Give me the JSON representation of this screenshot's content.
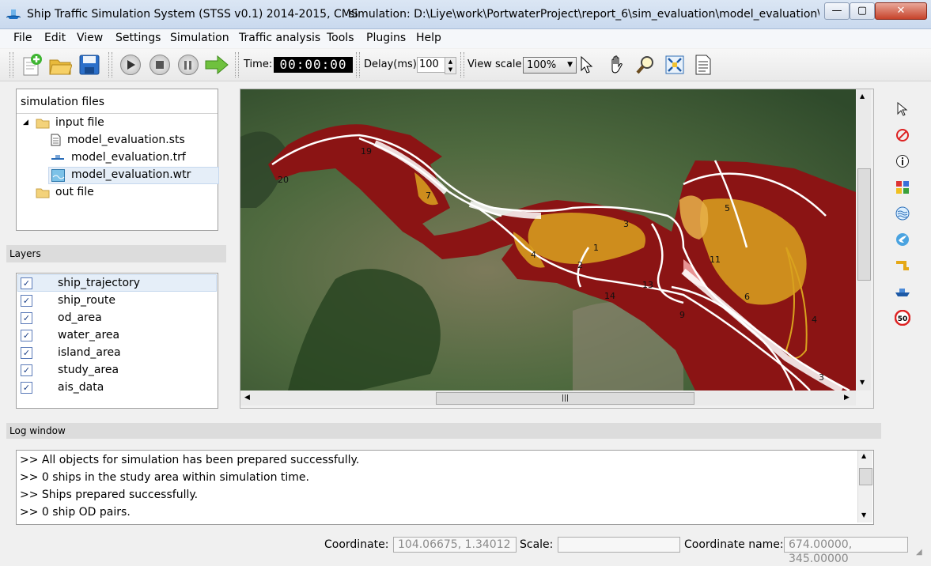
{
  "window": {
    "title": "Ship Traffic Simulation System (STSS v0.1) 2014-2015, CMS",
    "simulation_path": "simulation: D:\\Liye\\work\\PortwaterProject\\report_6\\sim_evaluation\\model_evaluation\\mo...",
    "min_label": "—",
    "max_label": "▢",
    "close_label": "✕"
  },
  "menu": [
    "File",
    "Edit",
    "View",
    "Settings",
    "Simulation",
    "Traffic analysis",
    "Tools",
    "Plugins",
    "Help"
  ],
  "toolbar": {
    "time_label": "Time:",
    "time_value": "00:00:00",
    "delay_label": "Delay(ms):",
    "delay_value": "100",
    "view_scale_label": "View scale:",
    "view_scale_value": "100%",
    "icons": [
      "new-file-icon",
      "open-folder-icon",
      "save-icon",
      "play-icon",
      "stop-icon",
      "pause-icon",
      "next-arrow-icon",
      "pointer-icon",
      "pan-hand-icon",
      "zoom-icon",
      "fit-view-icon",
      "report-icon"
    ]
  },
  "files_panel": {
    "header": "simulation files",
    "input_folder": "input file",
    "files": [
      "model_evaluation.sts",
      "model_evaluation.trf",
      "model_evaluation.wtr"
    ],
    "output_folder": "out file"
  },
  "layers": {
    "title": "Layers",
    "items": [
      {
        "label": "ship_trajectory",
        "checked": true
      },
      {
        "label": "ship_route",
        "checked": true
      },
      {
        "label": "od_area",
        "checked": true
      },
      {
        "label": "water_area",
        "checked": true
      },
      {
        "label": "island_area",
        "checked": true
      },
      {
        "label": "study_area",
        "checked": true
      },
      {
        "label": "ais_data",
        "checked": true
      }
    ]
  },
  "map": {
    "labels": [
      "19",
      "20",
      "7",
      "3",
      "1",
      "4",
      "2",
      "13",
      "14",
      "9",
      "5",
      "11",
      "6",
      "4",
      "3"
    ],
    "colors": {
      "water": "#8b1414",
      "od_area": "#d9a21e",
      "trajectory": "#ffffff",
      "land": "#3f5a33"
    }
  },
  "right_tools": [
    "select-arrow-icon",
    "no-entry-icon",
    "info-icon",
    "puzzle-icon",
    "waves-icon",
    "bird-icon",
    "route-icon",
    "ship-icon",
    "speed-limit-icon"
  ],
  "speed_limit_text": "50",
  "log": {
    "title": "Log window",
    "lines": [
      ">> All objects for simulation has been prepared successfully.",
      ">> 0 ships in the study area within simulation time.",
      ">> Ships prepared successfully.",
      ">> 0 ship OD pairs."
    ]
  },
  "status": {
    "coordinate_label": "Coordinate:",
    "coordinate_value": "104.06675, 1.34012",
    "scale_label": "Scale:",
    "scale_value": "",
    "coordinate_name_label": "Coordinate name:",
    "coordinate_name_value": "674.00000, 345.00000"
  }
}
